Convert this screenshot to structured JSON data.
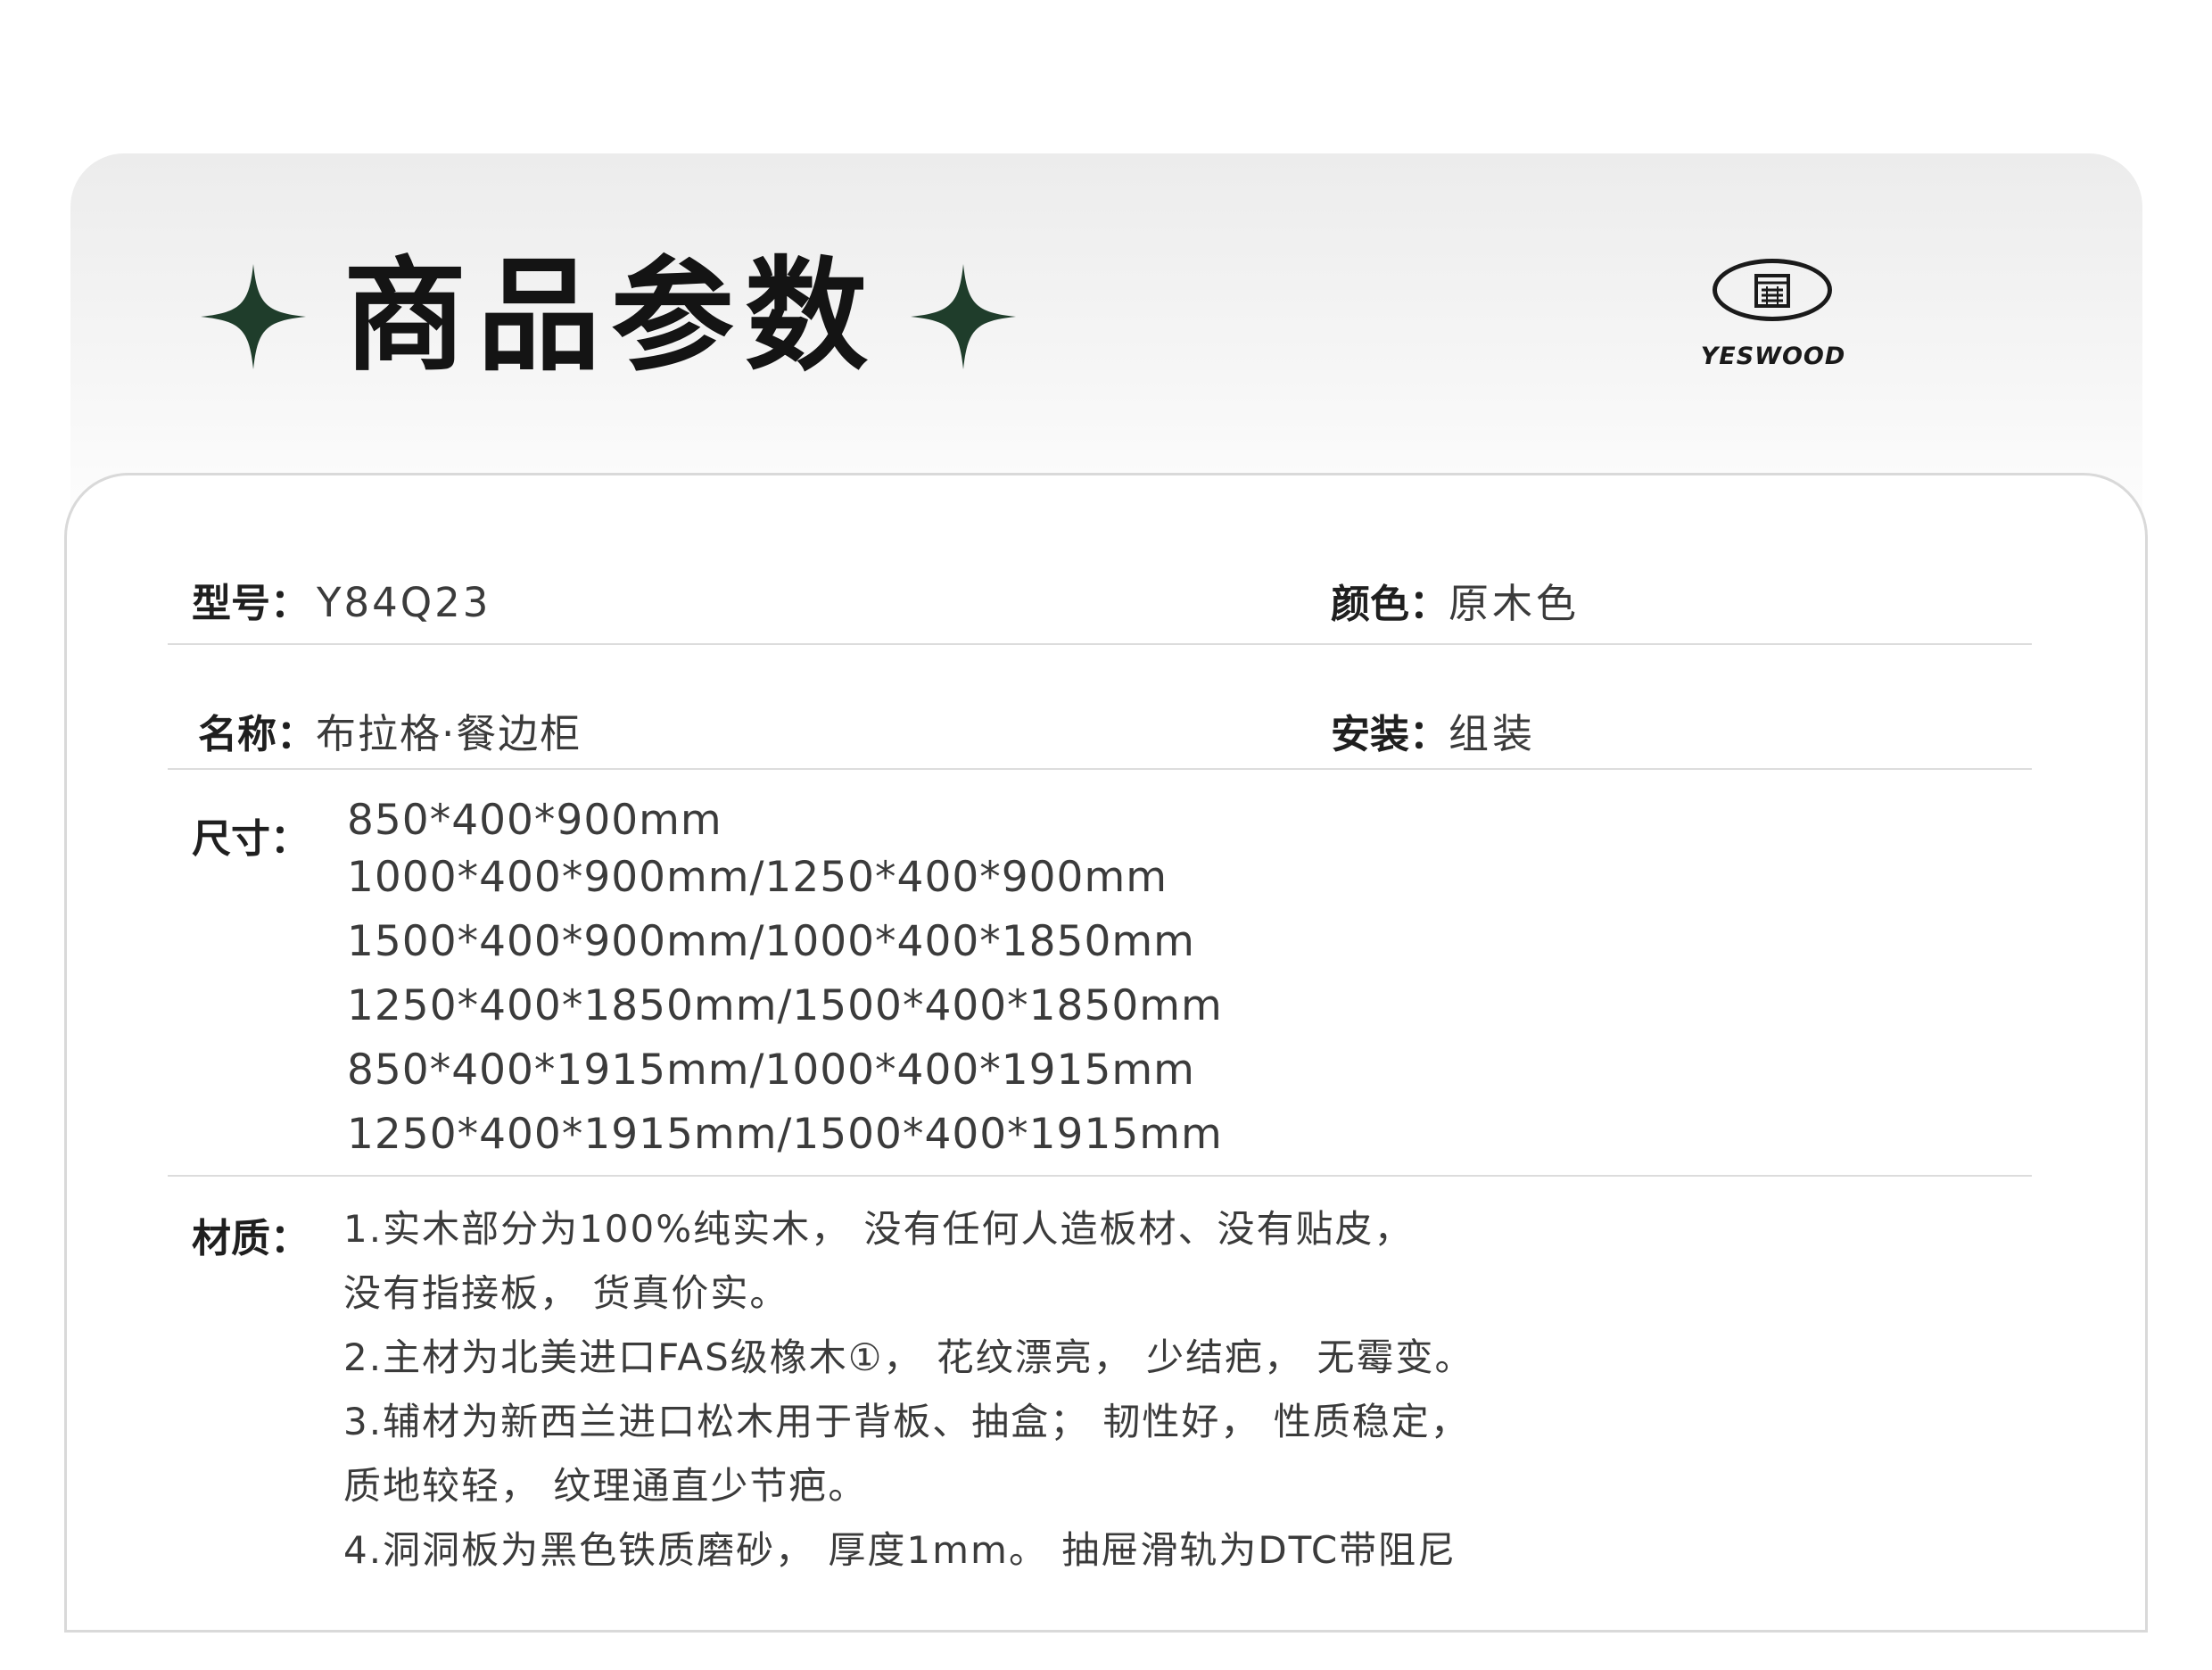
{
  "header": {
    "title": "商品参数",
    "logo_text": "YESWOOD",
    "accent_color": "#1f3d2b"
  },
  "params": {
    "model": {
      "label": "型号：",
      "value": "Y84Q23"
    },
    "color": {
      "label": "颜色：",
      "value": "原木色"
    },
    "name": {
      "label": "名称：",
      "value": "布拉格·餐边柜"
    },
    "install": {
      "label": "安装：",
      "value": "组装"
    },
    "size": {
      "label": "尺寸：",
      "lines": [
        "850*400*900mm",
        "1000*400*900mm/1250*400*900mm",
        "1500*400*900mm/1000*400*1850mm",
        "1250*400*1850mm/1500*400*1850mm",
        "850*400*1915mm/1000*400*1915mm",
        "1250*400*1915mm/1500*400*1915mm"
      ]
    },
    "material": {
      "label": "材质：",
      "lines": [
        "1.实木部分为100%纯实木， 没有任何人造板材、没有贴皮，",
        "没有指接板， 货真价实。",
        "2.主材为北美进口FAS级橡木①， 花纹漂亮， 少结疤， 无霉变。",
        "3.辅材为新西兰进口松木用于背板、抽盒； 韧性好， 性质稳定，",
        "质地较轻， 纹理通直少节疤。",
        "4.洞洞板为黑色铁质磨砂， 厚度1mm。   抽屉滑轨为DTC带阻尼"
      ]
    }
  }
}
